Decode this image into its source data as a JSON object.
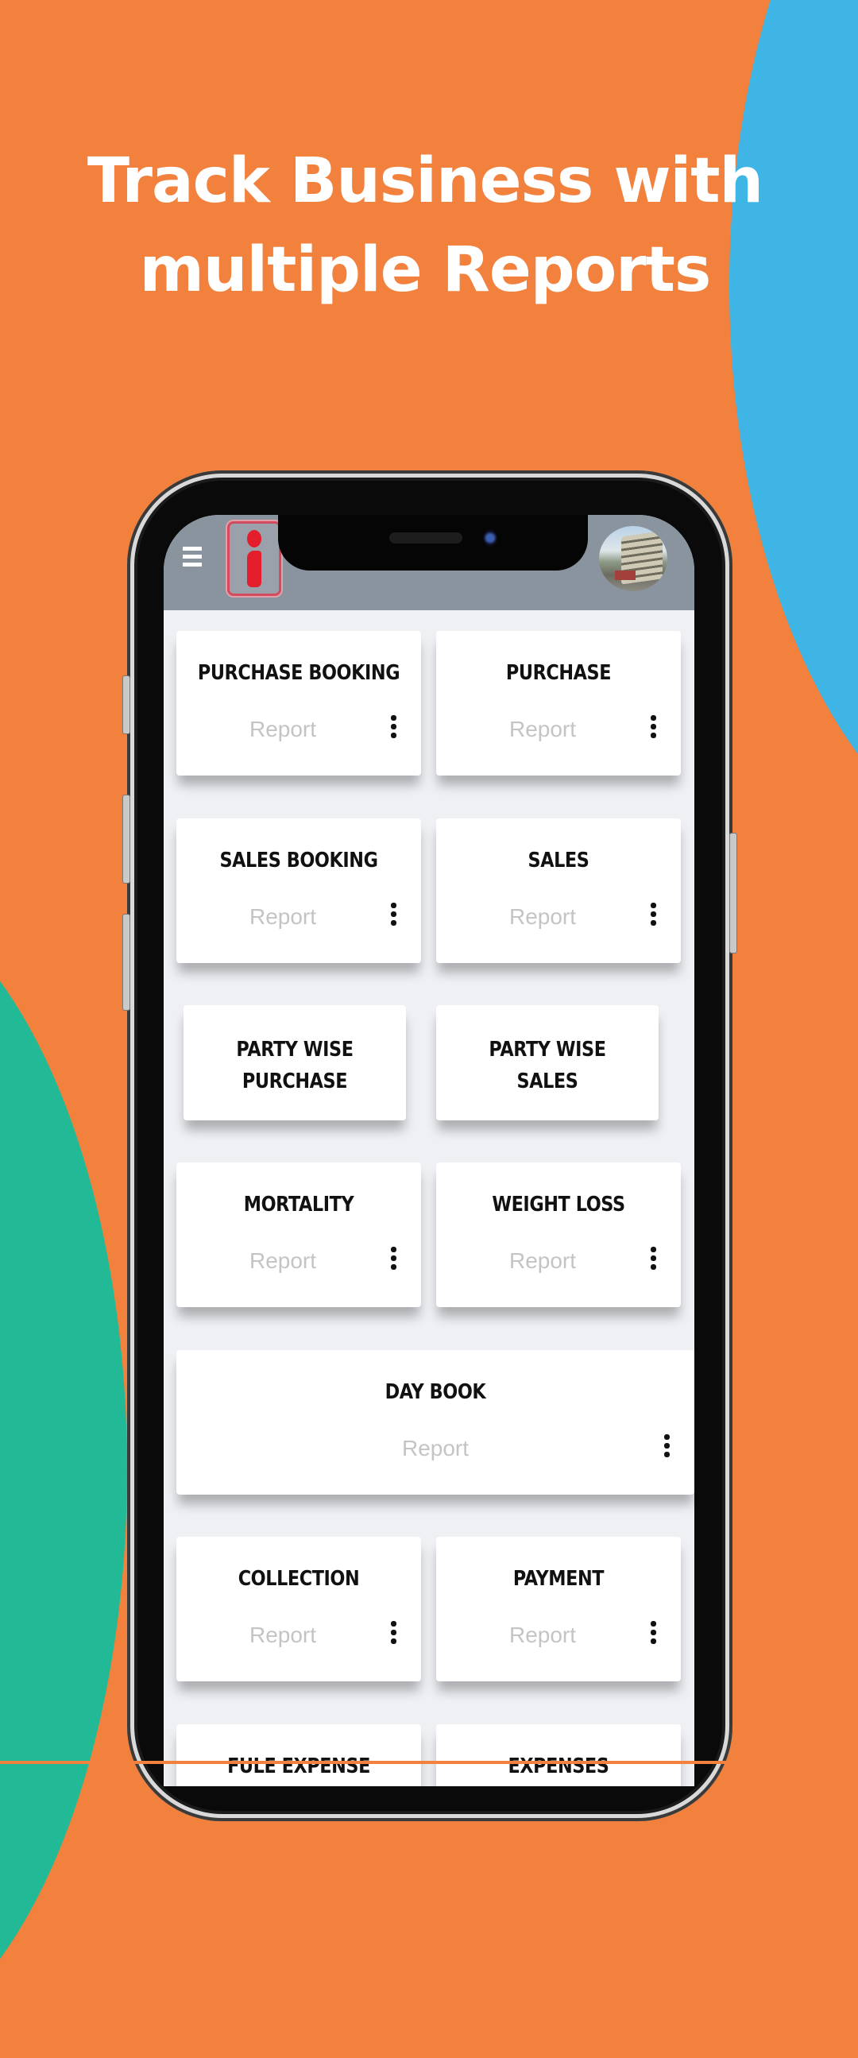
{
  "headline": {
    "line1": "Track Business with",
    "line2": "multiple Reports"
  },
  "colors": {
    "background": "#F2813D",
    "blue_blob": "#3FB5E6",
    "green_blob": "#22B996",
    "app_bar": "#8A949F",
    "logo_red": "#E31D2C"
  },
  "app": {
    "menu_icon": "hamburger-menu-icon",
    "logo_icon": "i-logo-icon",
    "avatar": "profile-avatar-truck-photo"
  },
  "cards": [
    {
      "title": "PURCHASE BOOKING",
      "subtitle": "Report",
      "has_menu": true
    },
    {
      "title": "PURCHASE",
      "subtitle": "Report",
      "has_menu": true
    },
    {
      "title": "SALES BOOKING",
      "subtitle": "Report",
      "has_menu": true
    },
    {
      "title": "SALES",
      "subtitle": "Report",
      "has_menu": true
    },
    {
      "title": "PARTY WISE PURCHASE",
      "title_line1": "PARTY WISE",
      "title_line2": "PURCHASE",
      "has_menu": false
    },
    {
      "title": "PARTY WISE SALES",
      "title_line1": "PARTY WISE",
      "title_line2": "SALES",
      "has_menu": false
    },
    {
      "title": "MORTALITY",
      "subtitle": "Report",
      "has_menu": true
    },
    {
      "title": "WEIGHT LOSS",
      "subtitle": "Report",
      "has_menu": true
    },
    {
      "title": "DAY BOOK",
      "subtitle": "Report",
      "has_menu": true
    },
    {
      "title": "COLLECTION",
      "subtitle": "Report",
      "has_menu": true
    },
    {
      "title": "PAYMENT",
      "subtitle": "Report",
      "has_menu": true
    },
    {
      "title": "FULE EXPENSE",
      "subtitle": "",
      "has_menu": false
    },
    {
      "title": "EXPENSES",
      "subtitle": "",
      "has_menu": false
    }
  ]
}
